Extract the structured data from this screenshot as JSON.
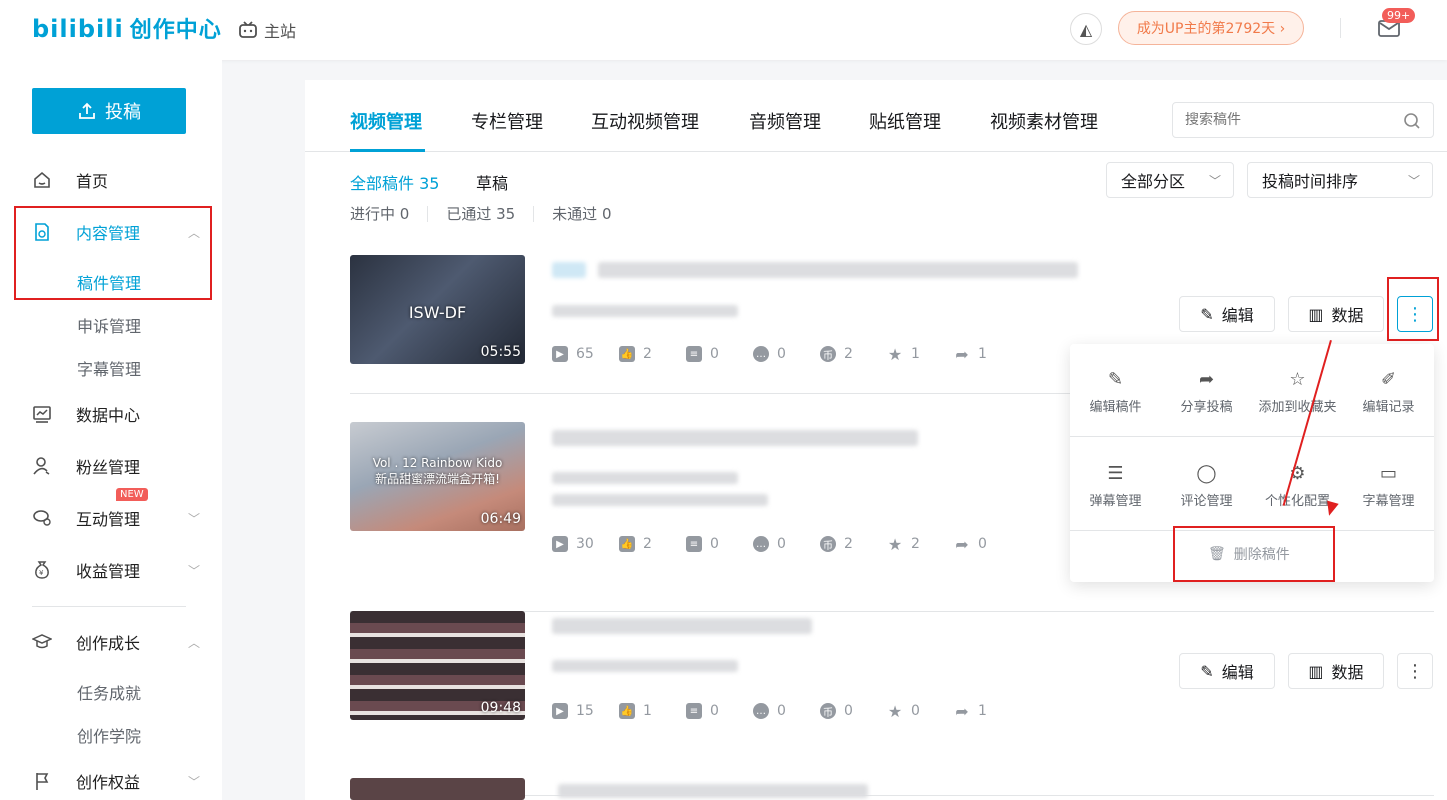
{
  "header": {
    "logo_text": "bilibili",
    "logo_cn": "创作中心",
    "main_site": "主站",
    "days_badge": "成为UP主的第2792天 ›",
    "mail_count": "99+"
  },
  "sidebar": {
    "upload_label": "投稿",
    "items": {
      "home": "首页",
      "content": "内容管理",
      "manuscript": "稿件管理",
      "appeal": "申诉管理",
      "subtitle": "字幕管理",
      "data_center": "数据中心",
      "fans": "粉丝管理",
      "interaction": "互动管理",
      "income": "收益管理",
      "income_badge": "NEW",
      "growth": "创作成长",
      "tasks": "任务成就",
      "academy": "创作学院",
      "rights": "创作权益"
    }
  },
  "tabs": [
    "视频管理",
    "专栏管理",
    "互动视频管理",
    "音频管理",
    "贴纸管理",
    "视频素材管理"
  ],
  "search": {
    "placeholder": "搜索稿件"
  },
  "filters": {
    "all": "全部稿件 35",
    "draft": "草稿",
    "in_progress": "进行中 0",
    "passed": "已通过 35",
    "failed": "未通过 0",
    "zone_select": "全部分区",
    "sort_select": "投稿时间排序"
  },
  "videos": [
    {
      "thumb_text": "ISW-DF",
      "duration": "05:55",
      "stats": {
        "play": "65",
        "like": "2",
        "danmaku": "0",
        "comment": "0",
        "coin": "2",
        "fav": "1",
        "share": "1"
      }
    },
    {
      "thumb_text": "Vol . 12 Rainbow Kido\n新品甜蜜漂流端盒开箱!",
      "duration": "06:49",
      "stats": {
        "play": "30",
        "like": "2",
        "danmaku": "0",
        "comment": "0",
        "coin": "2",
        "fav": "2",
        "share": "0"
      }
    },
    {
      "thumb_text": "",
      "duration": "09:48",
      "stats": {
        "play": "15",
        "like": "1",
        "danmaku": "0",
        "comment": "0",
        "coin": "0",
        "fav": "0",
        "share": "1"
      }
    }
  ],
  "actions": {
    "edit": "编辑",
    "data": "数据"
  },
  "menu": {
    "edit_manuscript": "编辑稿件",
    "share": "分享投稿",
    "add_fav": "添加到收藏夹",
    "edit_record": "编辑记录",
    "danmaku_mgmt": "弹幕管理",
    "comment_mgmt": "评论管理",
    "custom_config": "个性化配置",
    "subtitle_mgmt": "字幕管理",
    "delete": "删除稿件"
  },
  "colors": {
    "accent": "#00a1d6",
    "highlight": "#e02020",
    "badge": "#f25d59"
  }
}
